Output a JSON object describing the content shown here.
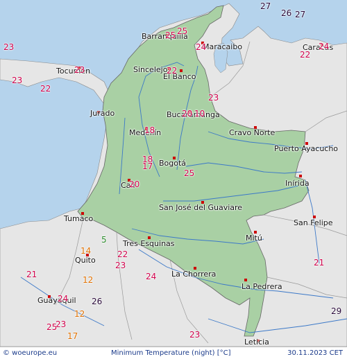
{
  "footer": {
    "brand": "© woeurope.eu",
    "title": "Minimum Temperature (night) [°C]",
    "date": "30.11.2023 CET"
  },
  "colors": {
    "land": "#e6e6e6",
    "colombia": "#a9d0a4",
    "sea": "#b5d3ec",
    "border": "#777777",
    "river": "#3b78c8",
    "city": "#cc0000"
  },
  "cities": [
    {
      "name": "Barranquilla"
    },
    {
      "name": "Maracaibo"
    },
    {
      "name": "Tocumen"
    },
    {
      "name": "Sincelejo"
    },
    {
      "name": "El Banco"
    },
    {
      "name": "Caracas"
    },
    {
      "name": "Jurado"
    },
    {
      "name": "Bucaramanga"
    },
    {
      "name": "Medellín"
    },
    {
      "name": "Cravo Norte"
    },
    {
      "name": "Puerto Ayacucho"
    },
    {
      "name": "Bogotá"
    },
    {
      "name": "Cali"
    },
    {
      "name": "Inírida"
    },
    {
      "name": "San José del Guaviare"
    },
    {
      "name": "Tumaco"
    },
    {
      "name": "San Felipe"
    },
    {
      "name": "Tres Esquinas"
    },
    {
      "name": "Mitú"
    },
    {
      "name": "Quito"
    },
    {
      "name": "La Chorrera"
    },
    {
      "name": "La Pedrera"
    },
    {
      "name": "Guayaquil"
    },
    {
      "name": "Leticia"
    }
  ],
  "temperatures": [
    {
      "value": "27",
      "color": "#2a0a3a"
    },
    {
      "value": "26",
      "color": "#2a0a3a"
    },
    {
      "value": "27",
      "color": "#2a0a3a"
    },
    {
      "value": "25",
      "color": "#d0004a"
    },
    {
      "value": "25",
      "color": "#d0004a"
    },
    {
      "value": "23",
      "color": "#d0004a"
    },
    {
      "value": "24",
      "color": "#d0004a"
    },
    {
      "value": "24",
      "color": "#d0004a"
    },
    {
      "value": "22",
      "color": "#d0004a"
    },
    {
      "value": "23",
      "color": "#d0004a"
    },
    {
      "value": "23",
      "color": "#d0004a"
    },
    {
      "value": "22",
      "color": "#d0004a"
    },
    {
      "value": "22",
      "color": "#d0004a"
    },
    {
      "value": "23",
      "color": "#d0004a"
    },
    {
      "value": "20",
      "color": "#d0004a"
    },
    {
      "value": "10",
      "color": "#d0004a"
    },
    {
      "value": "18",
      "color": "#d0004a"
    },
    {
      "value": "18",
      "color": "#d0004a"
    },
    {
      "value": "17",
      "color": "#d0004a"
    },
    {
      "value": "25",
      "color": "#d0004a"
    },
    {
      "value": "20",
      "color": "#d0004a"
    },
    {
      "value": "5",
      "color": "#2a8a2a"
    },
    {
      "value": "14",
      "color": "#e07000"
    },
    {
      "value": "22",
      "color": "#d0004a"
    },
    {
      "value": "23",
      "color": "#d0004a"
    },
    {
      "value": "24",
      "color": "#d0004a"
    },
    {
      "value": "21",
      "color": "#d0004a"
    },
    {
      "value": "21",
      "color": "#d0004a"
    },
    {
      "value": "12",
      "color": "#e07000"
    },
    {
      "value": "24",
      "color": "#d0004a"
    },
    {
      "value": "26",
      "color": "#2a0a3a"
    },
    {
      "value": "12",
      "color": "#e07000"
    },
    {
      "value": "29",
      "color": "#2a0a3a"
    },
    {
      "value": "23",
      "color": "#d0004a"
    },
    {
      "value": "25",
      "color": "#d0004a"
    },
    {
      "value": "17",
      "color": "#e07000"
    },
    {
      "value": "23",
      "color": "#d0004a"
    }
  ]
}
